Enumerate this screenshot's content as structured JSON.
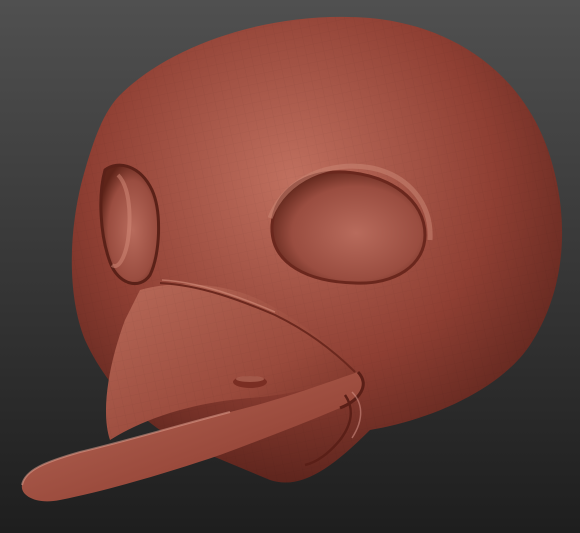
{
  "viewport": {
    "background_top": "#505050",
    "background_bottom": "#1e1e1e"
  },
  "model": {
    "subject": "bird-skull-mask-head",
    "material_color": "#8f3f33",
    "material_highlight": "#c0705f",
    "material_shadow": "#4a1a14",
    "parts": [
      "head-dome",
      "left-eye-socket",
      "right-eye-socket",
      "beak-upper",
      "beak-lower",
      "nostril",
      "beak-seam"
    ],
    "wireframe_overlay": true
  }
}
